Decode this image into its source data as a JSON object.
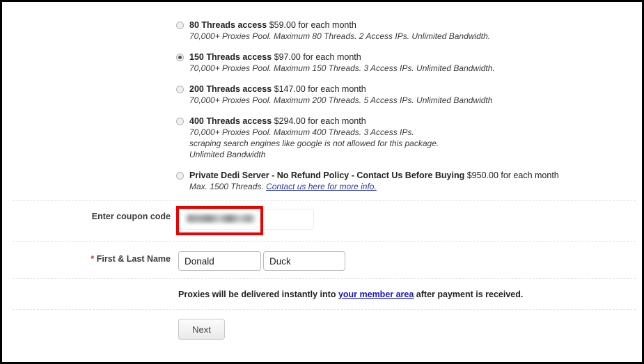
{
  "plans": {
    "options": [
      {
        "name": "80 Threads access",
        "price": "$59.00 for each month",
        "description": "70,000+ Proxies Pool. Maximum 80 Threads. 2 Access IPs. Unlimited Bandwidth.",
        "selected": false
      },
      {
        "name": "150 Threads access",
        "price": "$97.00 for each month",
        "description": "70,000+ Proxies Pool. Maximum 150 Threads. 3 Access IPs. Unlimited Bandwidth.",
        "selected": true
      },
      {
        "name": "200 Threads access",
        "price": "$147.00 for each month",
        "description": "70,000+ Proxies Pool. Maximum 200 Threads. 5 Access IPs. Unlimited Bandwidth",
        "selected": false
      },
      {
        "name": "400 Threads access",
        "price": "$294.00 for each month",
        "description_line1": "70,000+ Proxies Pool. Maximum 400 Threads. 3 Access IPs.",
        "description_line2": "scraping search engines like google is not allowed for this package.",
        "description_line3": "Unlimited Bandwidth",
        "selected": false
      },
      {
        "name": "Private Dedi Server - No Refund Policy - Contact Us Before Buying",
        "price": "$950.00 for each month",
        "description_prefix": "Max. 1500 Threads. ",
        "description_link": "Contact us here for more info.",
        "selected": false
      }
    ]
  },
  "form": {
    "coupon_label": "Enter coupon code",
    "coupon_value": "",
    "coupon_placeholder": "",
    "name_label_required_mark": "*",
    "name_label": "First & Last Name",
    "first_name_value": "Donald",
    "last_name_value": "Duck"
  },
  "delivery": {
    "text_before": "Proxies will be delivered instantly into ",
    "link_text": "your member area",
    "text_after": " after payment is received."
  },
  "actions": {
    "next_label": "Next"
  },
  "colors": {
    "annotation_red": "#ee0000",
    "link_blue": "#1414d0",
    "plan_link_blue": "#2a3aad",
    "required_red": "#c0392b",
    "page_border": "#000000",
    "separator": "#dedede"
  }
}
